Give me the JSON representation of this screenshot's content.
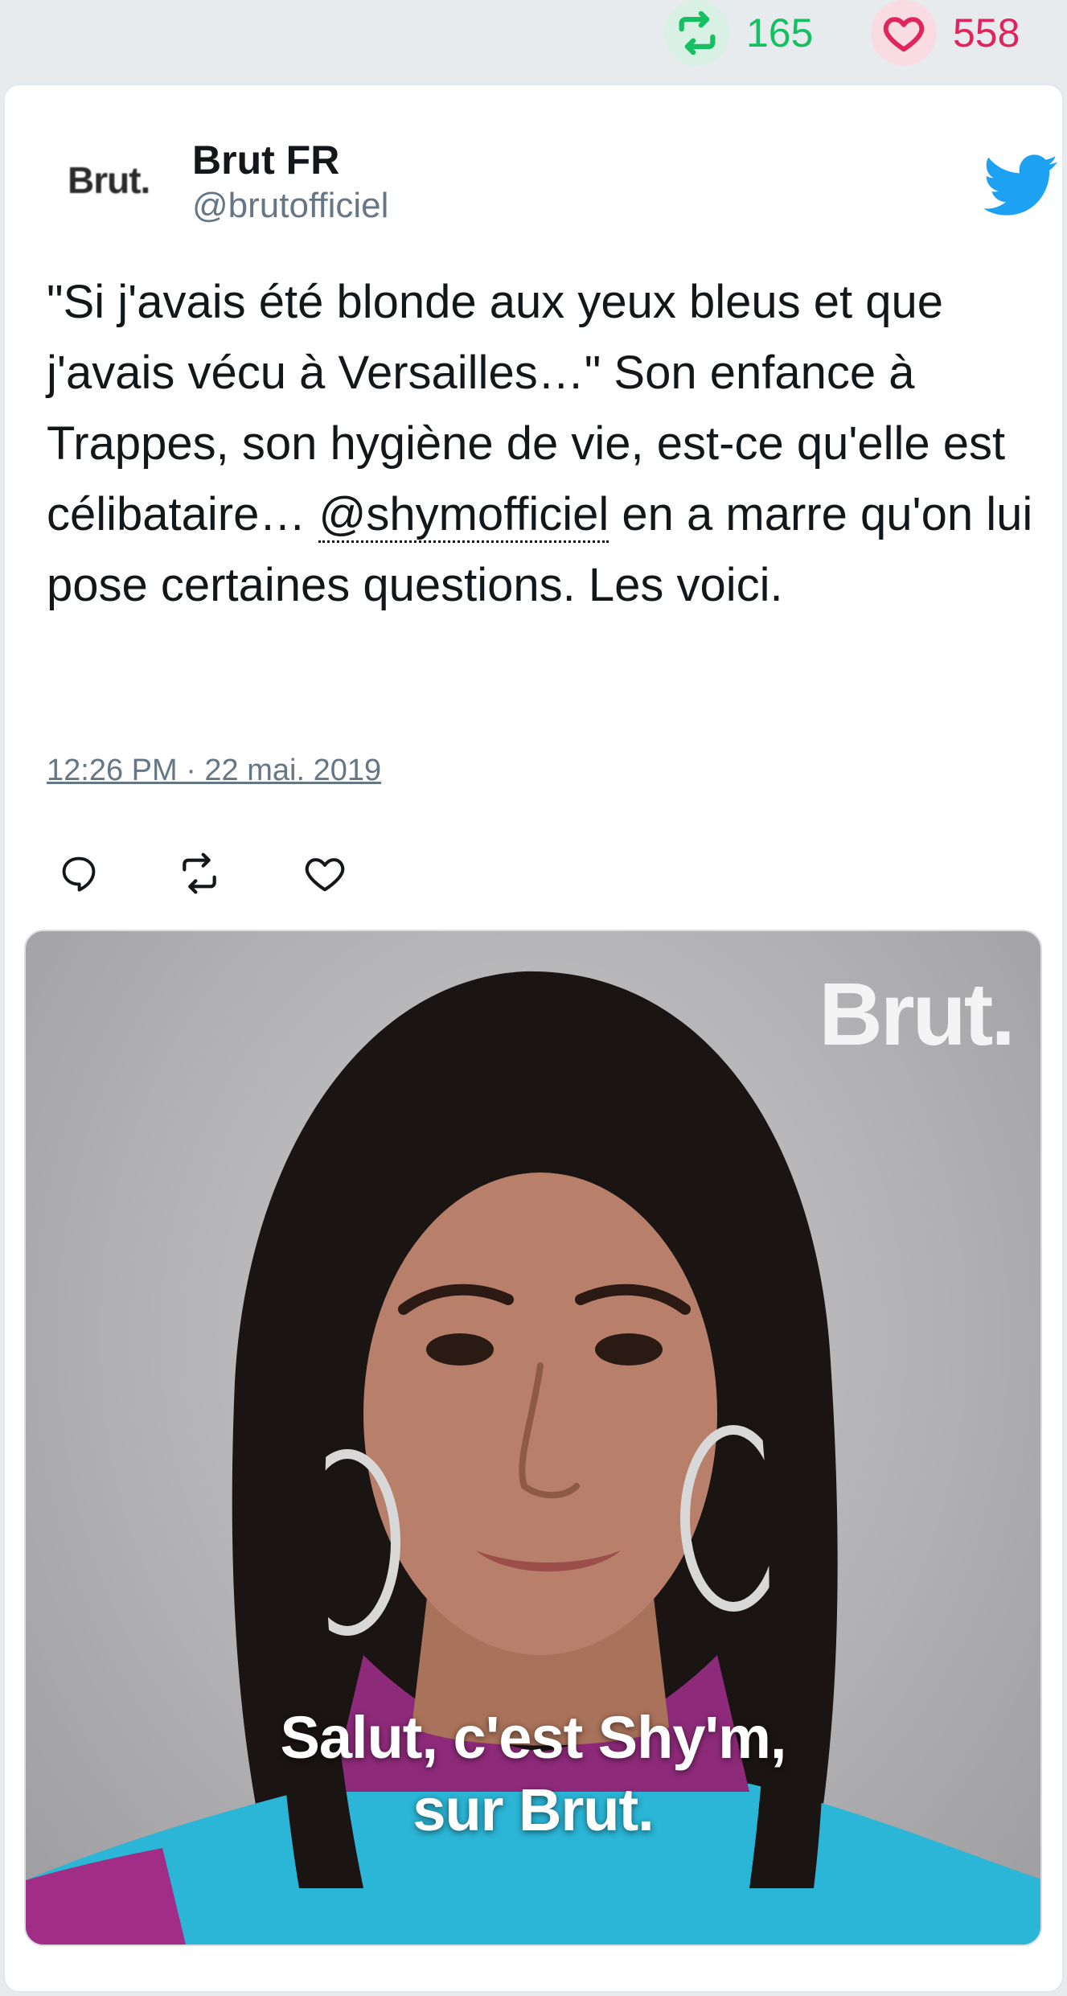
{
  "stats": {
    "retweet_count": "165",
    "like_count": "558",
    "retweet_color": "#17bf63",
    "like_color": "#e0245e"
  },
  "tweet": {
    "author_name": "Brut FR",
    "author_handle": "@brutofficiel",
    "avatar_logo": "Brut.",
    "text_before_mention": "\"Si j'avais été blonde aux yeux bleus et que j'avais vécu à Versailles…\" Son enfance à Trappes, son hygiène de vie, est-ce qu'elle est célibataire… ",
    "mention": "@shymofficiel",
    "text_after_mention": " en a marre qu'on lui pose certaines questions. Les voici.",
    "timestamp": "12:26 PM · 22 mai. 2019",
    "brand_icon": "twitter-bird-icon",
    "brand_color": "#1da1f2"
  },
  "actions": [
    {
      "icon": "reply-icon"
    },
    {
      "icon": "retweet-icon"
    },
    {
      "icon": "like-icon"
    }
  ],
  "media": {
    "watermark": "Brut.",
    "caption_line1": "Salut, c'est Shy'm,",
    "caption_line2": "sur Brut."
  }
}
